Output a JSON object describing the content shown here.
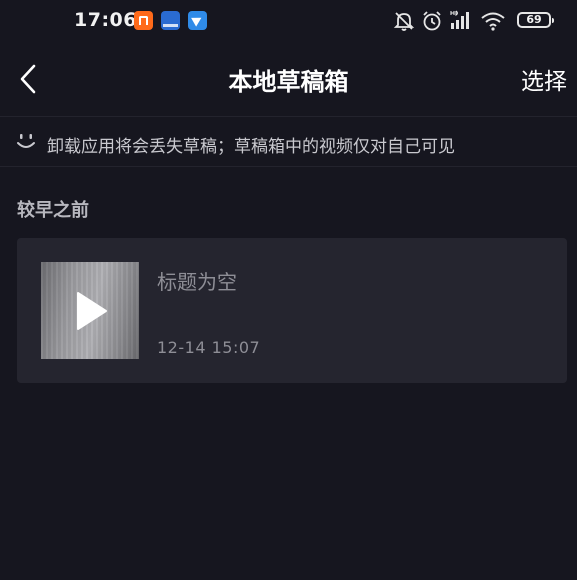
{
  "status_bar": {
    "time": "17:06",
    "battery": "69",
    "app_icons": [
      "mi-app-icon",
      "dictionary-app-icon",
      "feishu-app-icon"
    ],
    "system_icons": [
      "bell-off-icon",
      "alarm-icon",
      "hd-signal-icon",
      "wifi-icon",
      "battery-icon"
    ]
  },
  "nav": {
    "title": "本地草稿箱",
    "select_label": "选择",
    "back_icon": "chevron-left-icon"
  },
  "notice": {
    "icon": "smile-icon",
    "text": "卸载应用将会丢失草稿；草稿箱中的视频仅对自己可见"
  },
  "sections": [
    {
      "heading": "较早之前",
      "drafts": [
        {
          "title": "标题为空",
          "time": "12-14 15:07",
          "thumb_icon": "play-icon"
        }
      ]
    }
  ],
  "colors": {
    "background": "#16161f",
    "card": "#25252f",
    "secondary_text": "#8e8e96"
  }
}
